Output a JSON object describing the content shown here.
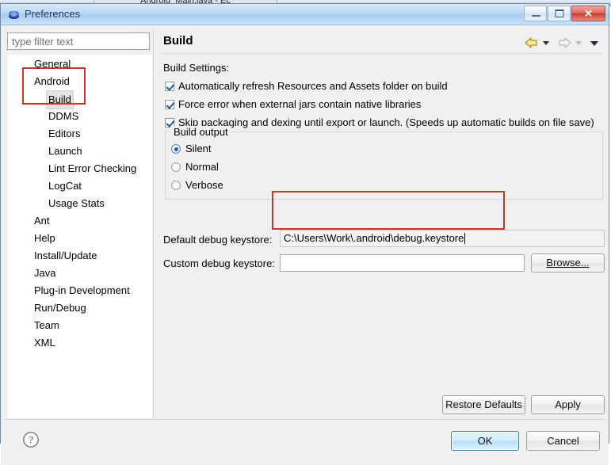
{
  "background": {
    "parent_window_title_fragment": "Android_Main.java - Ec"
  },
  "dialog": {
    "title": "Preferences",
    "icon": "preferences-icon",
    "window_buttons": [
      {
        "name": "minimize",
        "glyph": "—"
      },
      {
        "name": "maximize",
        "glyph": "❐"
      },
      {
        "name": "close",
        "glyph": "✕"
      }
    ]
  },
  "filter": {
    "value": "",
    "placeholder": "type filter text"
  },
  "tree": {
    "items": [
      {
        "label": "General",
        "depth": 0,
        "selected": false
      },
      {
        "label": "Android",
        "depth": 0,
        "selected": false
      },
      {
        "label": "Build",
        "depth": 1,
        "selected": true
      },
      {
        "label": "DDMS",
        "depth": 1,
        "selected": false
      },
      {
        "label": "Editors",
        "depth": 1,
        "selected": false
      },
      {
        "label": "Launch",
        "depth": 1,
        "selected": false
      },
      {
        "label": "Lint Error Checking",
        "depth": 1,
        "selected": false
      },
      {
        "label": "LogCat",
        "depth": 1,
        "selected": false
      },
      {
        "label": "Usage Stats",
        "depth": 1,
        "selected": false
      },
      {
        "label": "Ant",
        "depth": 0,
        "selected": false
      },
      {
        "label": "Help",
        "depth": 0,
        "selected": false
      },
      {
        "label": "Install/Update",
        "depth": 0,
        "selected": false
      },
      {
        "label": "Java",
        "depth": 0,
        "selected": false
      },
      {
        "label": "Plug-in Development",
        "depth": 0,
        "selected": false
      },
      {
        "label": "Run/Debug",
        "depth": 0,
        "selected": false
      },
      {
        "label": "Team",
        "depth": 0,
        "selected": false
      },
      {
        "label": "XML",
        "depth": 0,
        "selected": false
      }
    ]
  },
  "page": {
    "title": "Build",
    "nav": {
      "back_icon": "back-arrow-icon",
      "back_dropdown_icon": "chevron-down-icon",
      "forward_icon": "forward-arrow-icon",
      "forward_dropdown_icon": "chevron-down-icon",
      "menu_dropdown_icon": "chevron-down-icon"
    },
    "settings_label": "Build Settings:",
    "checkboxes": [
      {
        "label": "Automatically refresh Resources and Assets folder on build",
        "checked": true
      },
      {
        "label": "Force error when external jars contain native libraries",
        "checked": true
      },
      {
        "label": "Skip packaging and dexing until export or launch. (Speeds up automatic builds on file save)",
        "checked": true
      }
    ],
    "build_output": {
      "group_title": "Build output",
      "options": [
        {
          "label": "Silent",
          "selected": true
        },
        {
          "label": "Normal",
          "selected": false
        },
        {
          "label": "Verbose",
          "selected": false
        }
      ]
    },
    "default_keystore": {
      "label": "Default debug keystore:",
      "value": "C:\\Users\\Work\\.android\\debug.keystore"
    },
    "custom_keystore": {
      "label": "Custom debug keystore:",
      "value": "",
      "browse_label": "Browse..."
    },
    "restore_defaults_label": "Restore Defaults",
    "apply_label": "Apply"
  },
  "footer": {
    "help_icon": "help-icon",
    "ok_label": "OK",
    "cancel_label": "Cancel"
  },
  "annotations": {
    "accent_color": "#c0392b",
    "highlight_tree": "Android / Build",
    "highlight_field": "Default debug keystore"
  }
}
